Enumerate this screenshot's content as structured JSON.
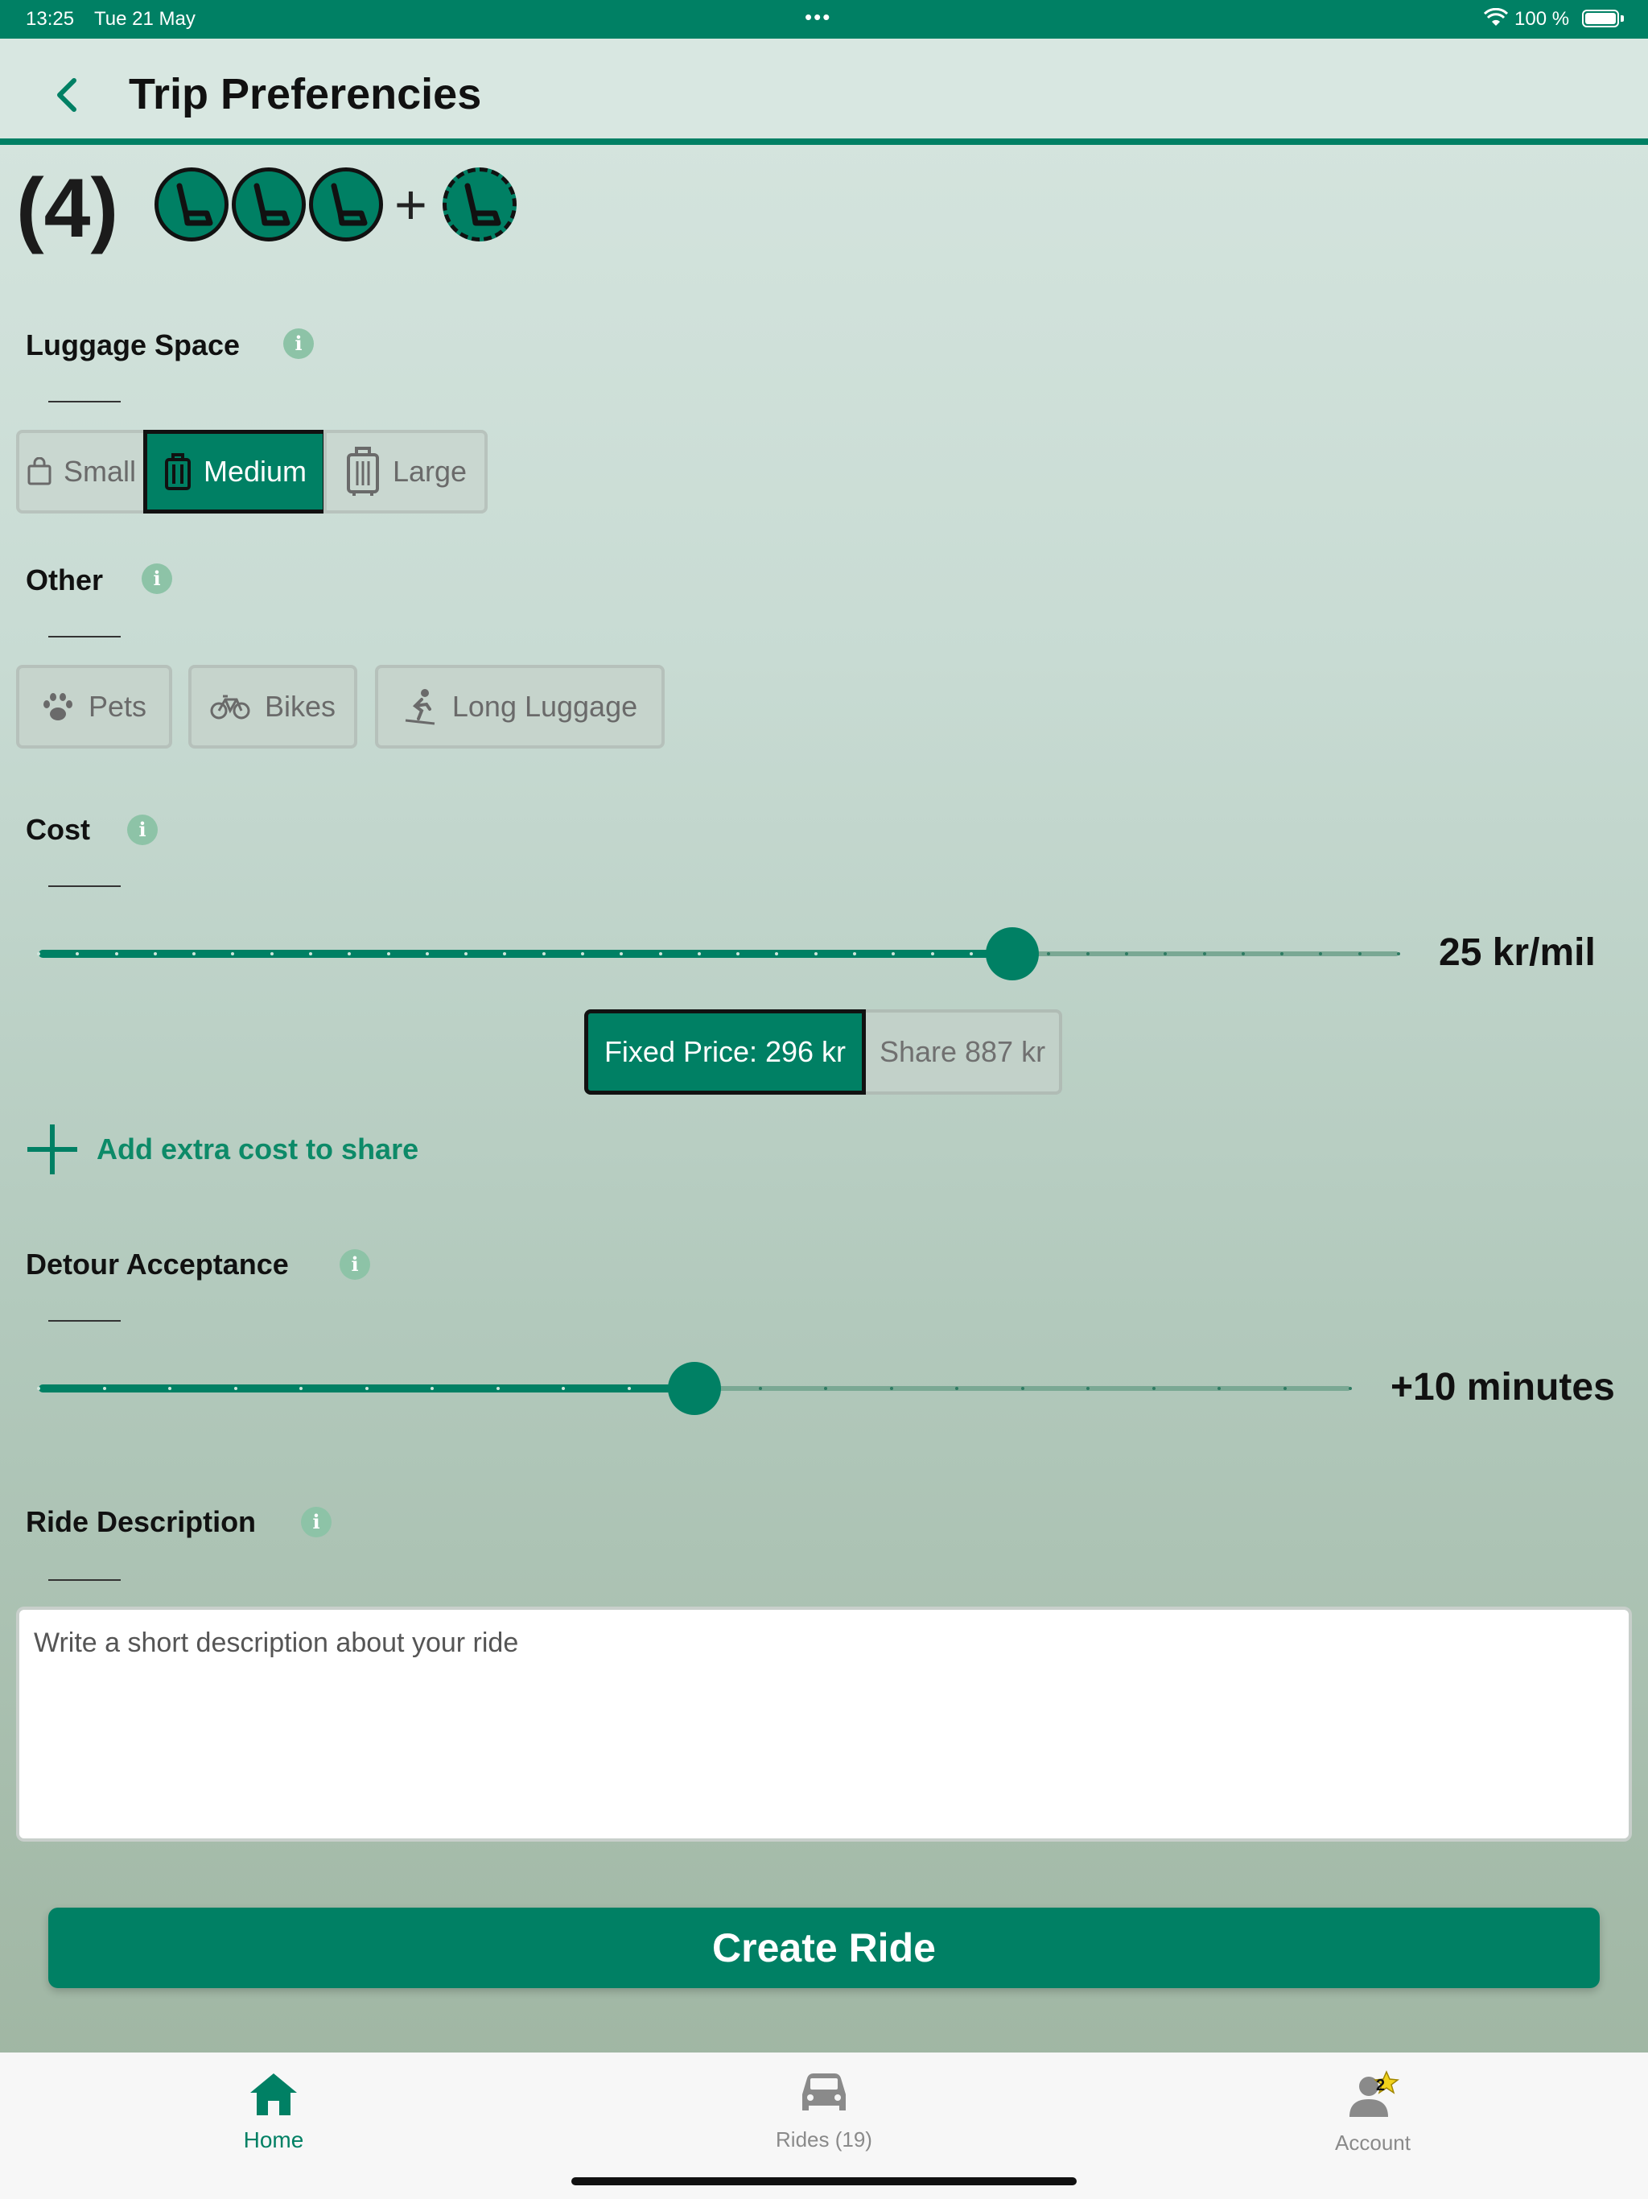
{
  "status_bar": {
    "time": "13:25",
    "date": "Tue 21 May",
    "battery": "100 %"
  },
  "header": {
    "title": "Trip Preferencies"
  },
  "seats": {
    "count_label": "(4)",
    "plus": "+"
  },
  "luggage": {
    "label": "Luggage Space",
    "options": [
      "Small",
      "Medium",
      "Large"
    ],
    "selected": "Medium"
  },
  "other": {
    "label": "Other",
    "options": [
      "Pets",
      "Bikes",
      "Long Luggage"
    ]
  },
  "cost": {
    "label": "Cost",
    "value_text": "25 kr/mil",
    "slider_fraction": 0.716,
    "fixed_price": "Fixed Price: 296 kr",
    "share": "Share 887 kr",
    "add_extra": "Add extra cost to share"
  },
  "detour": {
    "label": "Detour Acceptance",
    "value_text": "+10 minutes",
    "slider_fraction": 0.5
  },
  "ride_description": {
    "label": "Ride Description",
    "placeholder": "Write a short description about your ride"
  },
  "create_button": {
    "label": "Create Ride"
  },
  "tab_bar": {
    "home": "Home",
    "rides": "Rides (19)",
    "account": "Account",
    "account_badge": "2"
  },
  "colors": {
    "primary": "#008064",
    "info": "#8dc3a7"
  }
}
